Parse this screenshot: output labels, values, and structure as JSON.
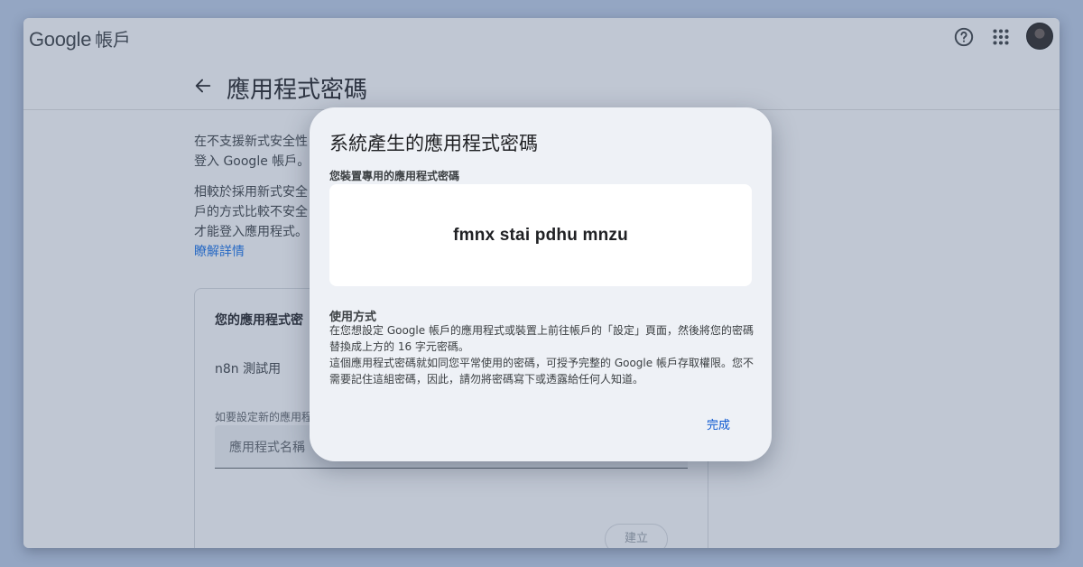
{
  "topbar": {
    "brand_google": "Google",
    "brand_account": "帳戶",
    "icons": [
      "help-icon",
      "apps-grid-icon",
      "avatar"
    ]
  },
  "header": {
    "title": "應用程式密碼"
  },
  "intro": {
    "p1": "在不支援新式安全性\n登入 Google 帳戶。",
    "p2": "相較於採用新式安全\n戶的方式比較不安全\n才能登入應用程式。",
    "learn_more": "瞭解詳情"
  },
  "card": {
    "title": "您的應用程式密",
    "app_name": "n8n 測試用",
    "new_hint": "如要設定新的應用程",
    "name_placeholder": "應用程式名稱",
    "create_label": "建立"
  },
  "dialog": {
    "title": "系統產生的應用程式密碼",
    "password_label": "您裝置專用的應用程式密碼",
    "password": "fmnx stai pdhu mnzu",
    "usage_title": "使用方式",
    "usage_p1": "在您想設定 Google 帳戶的應用程式或裝置上前往帳戶的「設定」頁面，然後將您的密碼替換成上方的 16 字元密碼。",
    "usage_p2": "這個應用程式密碼就如同您平常使用的密碼，可授予完整的 Google 帳戶存取權限。您不需要記住這組密碼，因此，請勿將密碼寫下或透露給任何人知道。",
    "done_label": "完成"
  },
  "colors": {
    "background": "#94a6c3",
    "dialog_bg": "#eef1f6",
    "link": "#1a73e8",
    "done": "#0b57d0"
  }
}
